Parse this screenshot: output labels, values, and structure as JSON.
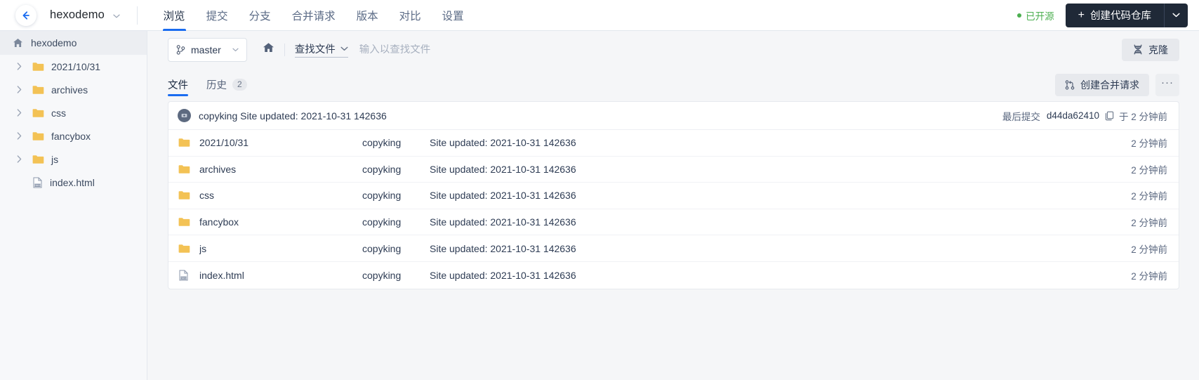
{
  "header": {
    "back_icon": "arrow-left-icon",
    "repo_name": "hexodemo",
    "repo_caret_icon": "chevron-down-icon",
    "nav_tabs": [
      {
        "label": "浏览",
        "active": true
      },
      {
        "label": "提交",
        "active": false
      },
      {
        "label": "分支",
        "active": false
      },
      {
        "label": "合并请求",
        "active": false
      },
      {
        "label": "版本",
        "active": false
      },
      {
        "label": "对比",
        "active": false
      },
      {
        "label": "设置",
        "active": false
      }
    ],
    "opensource_label": "已开源",
    "opensource_color": "#4caf50",
    "create_repo_label": "创建代码仓库",
    "create_repo_plus": "+",
    "create_repo_caret_icon": "chevron-down-icon"
  },
  "sidebar": {
    "root": {
      "label": "hexodemo",
      "icon": "home-icon"
    },
    "items": [
      {
        "label": "2021/10/31",
        "icon": "folder-icon",
        "type": "folder"
      },
      {
        "label": "archives",
        "icon": "folder-icon",
        "type": "folder"
      },
      {
        "label": "css",
        "icon": "folder-icon",
        "type": "folder"
      },
      {
        "label": "fancybox",
        "icon": "folder-icon",
        "type": "folder"
      },
      {
        "label": "js",
        "icon": "folder-icon",
        "type": "folder"
      },
      {
        "label": "index.html",
        "icon": "html-file-icon",
        "type": "file"
      }
    ]
  },
  "toolbar": {
    "branch_icon": "git-branch-icon",
    "branch_name": "master",
    "branch_caret_icon": "chevron-down-icon",
    "home_icon": "home-icon",
    "find_file_label": "查找文件",
    "find_file_caret_icon": "chevron-down-icon",
    "find_input_value": "",
    "find_input_placeholder": "输入以查找文件",
    "clone_label": "克隆",
    "clone_icon": "clone-icon"
  },
  "subtabs": {
    "tabs": [
      {
        "label": "文件",
        "count": "",
        "active": true
      },
      {
        "label": "历史",
        "count": "2",
        "active": false
      }
    ],
    "merge_request_label": "创建合并请求",
    "merge_request_icon": "merge-request-icon",
    "more_label": "···",
    "more_icon": "ellipsis-icon"
  },
  "commit_bar": {
    "avatar_alt": "copyking",
    "message": "copyking Site updated: 2021-10-31 142636",
    "last_commit_label": "最后提交",
    "sha": "d44da62410",
    "copy_icon": "copy-icon",
    "when": "于 2 分钟前"
  },
  "files": {
    "rows": [
      {
        "icon": "folder-icon",
        "type": "folder",
        "name": "2021/10/31",
        "author": "copyking",
        "message": "Site updated: 2021-10-31 142636",
        "time": "2 分钟前"
      },
      {
        "icon": "folder-icon",
        "type": "folder",
        "name": "archives",
        "author": "copyking",
        "message": "Site updated: 2021-10-31 142636",
        "time": "2 分钟前"
      },
      {
        "icon": "folder-icon",
        "type": "folder",
        "name": "css",
        "author": "copyking",
        "message": "Site updated: 2021-10-31 142636",
        "time": "2 分钟前"
      },
      {
        "icon": "folder-icon",
        "type": "folder",
        "name": "fancybox",
        "author": "copyking",
        "message": "Site updated: 2021-10-31 142636",
        "time": "2 分钟前"
      },
      {
        "icon": "folder-icon",
        "type": "folder",
        "name": "js",
        "author": "copyking",
        "message": "Site updated: 2021-10-31 142636",
        "time": "2 分钟前"
      },
      {
        "icon": "html-file-icon",
        "type": "file",
        "name": "index.html",
        "author": "copyking",
        "message": "Site updated: 2021-10-31 142636",
        "time": "2 分钟前"
      }
    ]
  },
  "colors": {
    "accent": "#1a6cf0",
    "folder": "#f3c255",
    "dark_button": "#1f2937",
    "text": "#2e3c54"
  }
}
